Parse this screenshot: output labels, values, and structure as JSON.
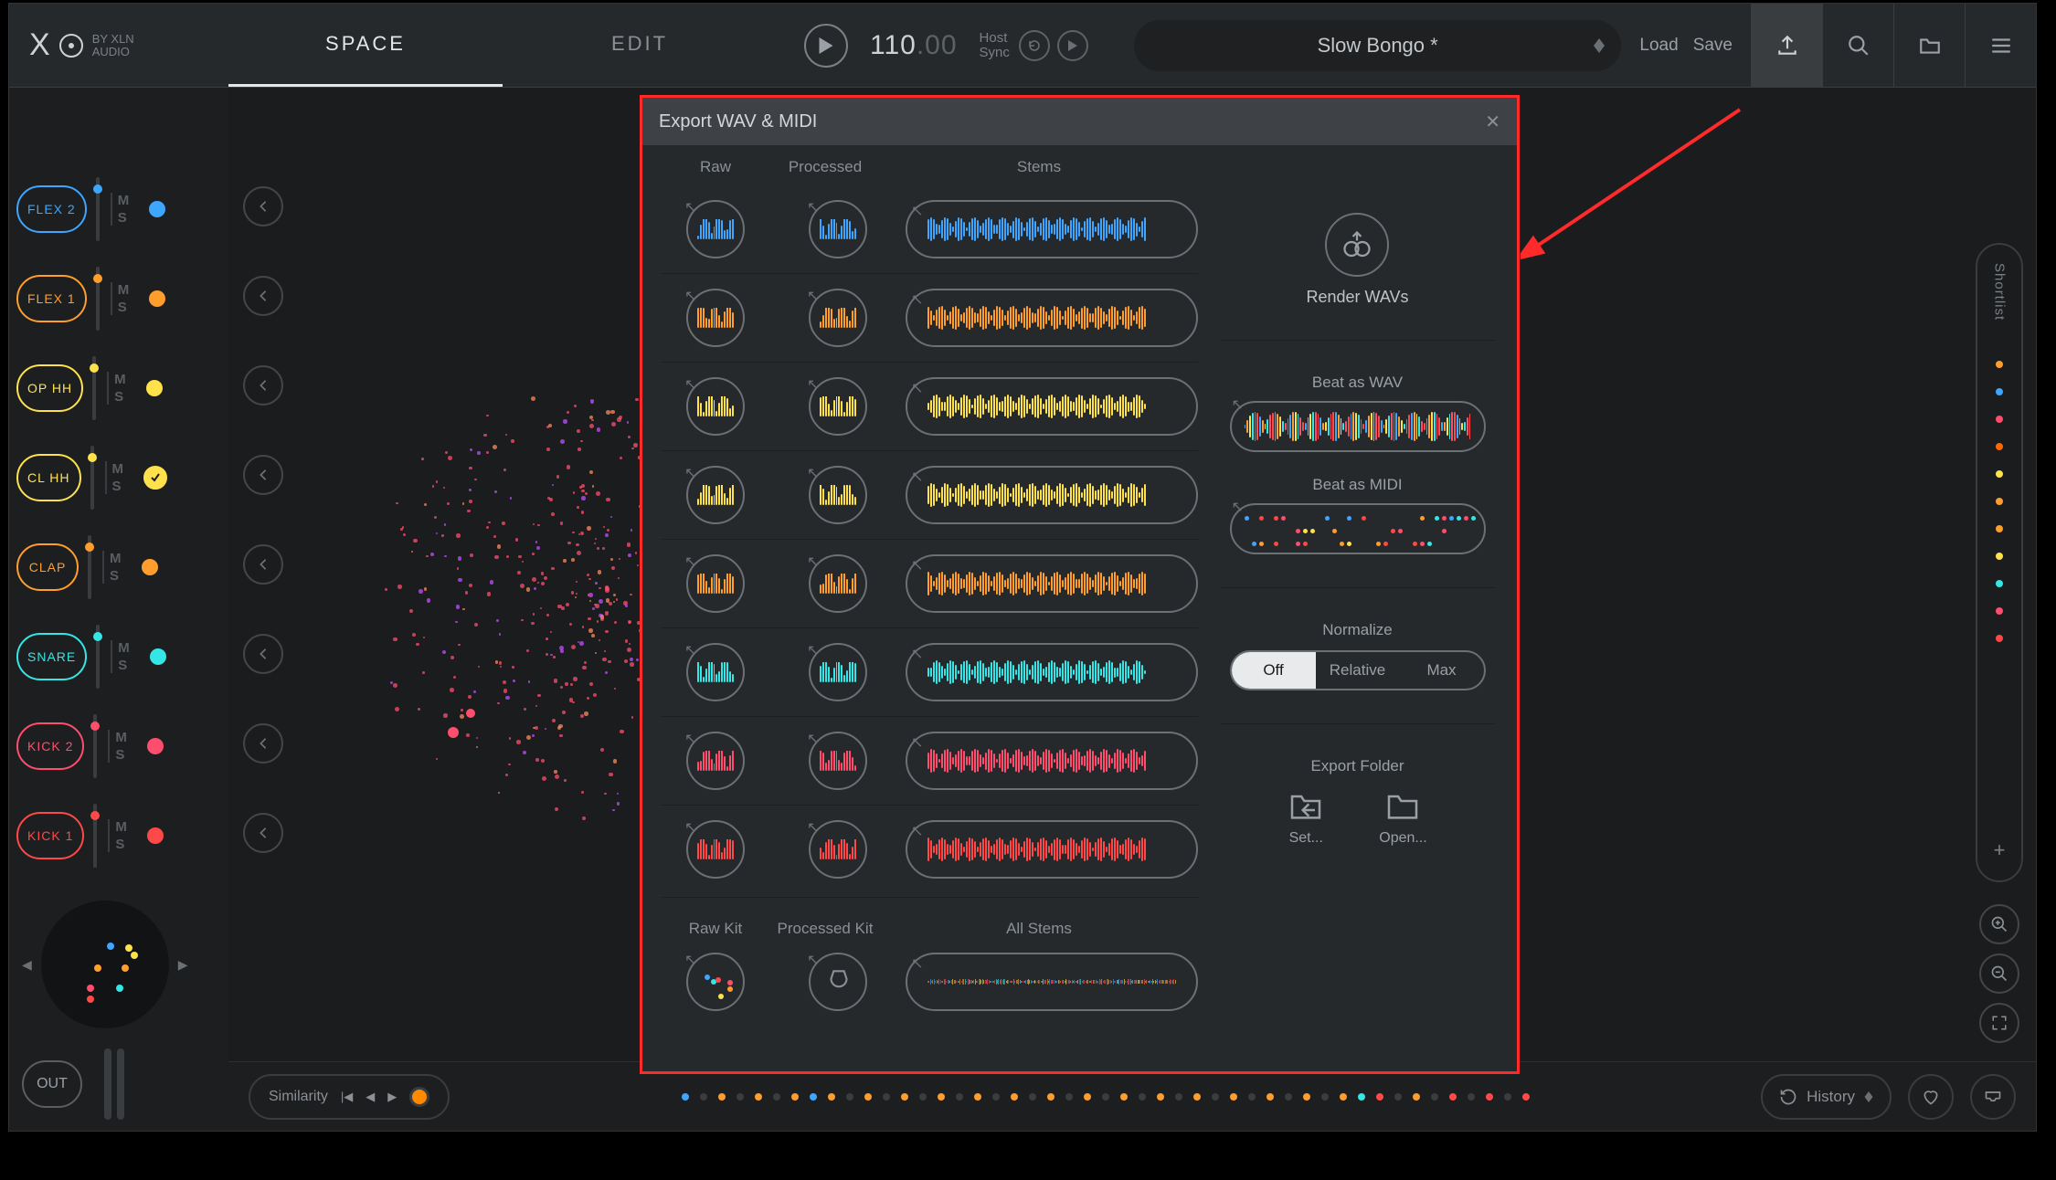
{
  "brand": {
    "logo": "XO",
    "by": "BY XLN",
    "audio": "AUDIO"
  },
  "tabs": {
    "space": "SPACE",
    "edit": "EDIT"
  },
  "transport": {
    "tempo_int": "110",
    "tempo_dec": ".00",
    "host": "Host",
    "sync": "Sync"
  },
  "preset": {
    "name": "Slow Bongo *",
    "load": "Load",
    "save": "Save"
  },
  "channels": [
    {
      "name": "FLEX 2",
      "color": "#3ea6ff"
    },
    {
      "name": "FLEX 1",
      "color": "#ff9e2c"
    },
    {
      "name": "OP HH",
      "color": "#ffe24b"
    },
    {
      "name": "CL HH",
      "color": "#ffe24b",
      "filled": true
    },
    {
      "name": "CLAP",
      "color": "#ff9e2c"
    },
    {
      "name": "SNARE",
      "color": "#35e6e6"
    },
    {
      "name": "KICK 2",
      "color": "#ff4d6d"
    },
    {
      "name": "KICK 1",
      "color": "#ff4848"
    }
  ],
  "ms": {
    "m": "M",
    "s": "S"
  },
  "out": "OUT",
  "shortlist": {
    "title": "Shortlist",
    "colors": [
      "#ff9e2c",
      "#3ea6ff",
      "#ff4d6d",
      "#ff6a00",
      "#ffe24b",
      "#ff9e2c",
      "#ff9e2c",
      "#ffe24b",
      "#35e6e6",
      "#ff4d6d",
      "#ff4848"
    ]
  },
  "bottom": {
    "similarity": "Similarity",
    "history": "History",
    "seq_colors": [
      "#3ea6ff",
      "",
      "#ff9e2c",
      "",
      "#ff9e2c",
      "",
      "#ff9e2c",
      "#3ea6ff",
      "#ff9e2c",
      "",
      "#ff9e2c",
      "",
      "#ff9e2c",
      "",
      "#ff9e2c",
      "",
      "#ff9e2c",
      "",
      "#ff9e2c",
      "",
      "#ff9e2c",
      "",
      "#ff9e2c",
      "",
      "#ff9e2c",
      "",
      "#ff9e2c",
      "",
      "#ff9e2c",
      "",
      "#ff9e2c",
      "",
      "#ff9e2c",
      "",
      "#ff9e2c",
      "",
      "#ff9e2c",
      "#35e6e6",
      "#ff4848",
      "",
      "#ff9e2c",
      "",
      "#ff4848",
      "",
      "#ff4848",
      "",
      "#ff4848"
    ]
  },
  "dialog": {
    "title": "Export WAV & MIDI",
    "headers": {
      "raw": "Raw",
      "processed": "Processed",
      "stems": "Stems"
    },
    "rows": [
      {
        "color": "#3ea6ff"
      },
      {
        "color": "#ff9e2c"
      },
      {
        "color": "#ffe24b"
      },
      {
        "color": "#ffe24b"
      },
      {
        "color": "#ff9e2c"
      },
      {
        "color": "#35e6e6"
      },
      {
        "color": "#ff4d6d"
      },
      {
        "color": "#ff4848"
      }
    ],
    "kit": {
      "raw": "Raw Kit",
      "processed": "Processed Kit",
      "stems": "All Stems"
    },
    "render": "Render WAVs",
    "beat_wav": "Beat as WAV",
    "beat_midi": "Beat as MIDI",
    "normalize": "Normalize",
    "norm_opts": {
      "off": "Off",
      "relative": "Relative",
      "max": "Max"
    },
    "folder": "Export Folder",
    "set": "Set...",
    "open": "Open..."
  }
}
